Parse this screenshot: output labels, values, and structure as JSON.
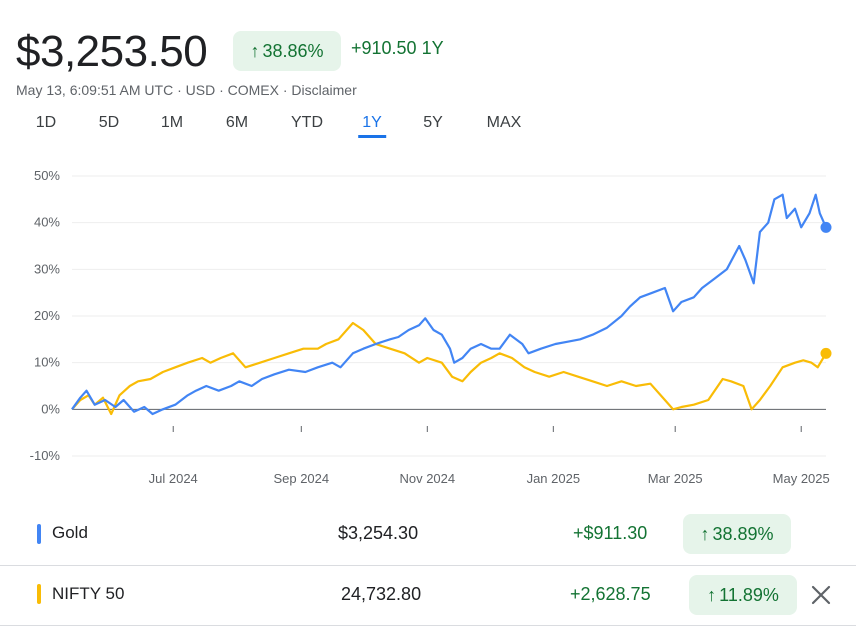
{
  "header": {
    "price": "$3,253.50",
    "change_pct": "38.86%",
    "change_abs": "+910.50 1Y",
    "meta": "May 13, 6:09:51 AM UTC · USD · COMEX · Disclaimer"
  },
  "tabs": [
    {
      "label": "1D",
      "active": false
    },
    {
      "label": "5D",
      "active": false
    },
    {
      "label": "1M",
      "active": false
    },
    {
      "label": "6M",
      "active": false
    },
    {
      "label": "YTD",
      "active": false
    },
    {
      "label": "1Y",
      "active": true
    },
    {
      "label": "5Y",
      "active": false
    },
    {
      "label": "MAX",
      "active": false
    }
  ],
  "chart_data": {
    "type": "line",
    "y_ticks": [
      "50%",
      "40%",
      "30%",
      "20%",
      "10%",
      "0%",
      "-10%"
    ],
    "ylim": [
      -10,
      50
    ],
    "xlim": [
      "2024-05-13",
      "2025-05-13"
    ],
    "x_ticks": [
      {
        "date": "2024-07-01",
        "label": "Jul 2024"
      },
      {
        "date": "2024-09-01",
        "label": "Sep 2024"
      },
      {
        "date": "2024-11-01",
        "label": "Nov 2024"
      },
      {
        "date": "2025-01-01",
        "label": "Jan 2025"
      },
      {
        "date": "2025-03-01",
        "label": "Mar 2025"
      },
      {
        "date": "2025-05-01",
        "label": "May 2025"
      }
    ],
    "grid": true,
    "series": [
      {
        "name": "Gold",
        "color": "#4285f4",
        "points": [
          [
            "2024-05-13",
            0
          ],
          [
            "2024-05-17",
            2.5
          ],
          [
            "2024-05-20",
            4
          ],
          [
            "2024-05-24",
            1
          ],
          [
            "2024-05-29",
            2
          ],
          [
            "2024-06-03",
            0.5
          ],
          [
            "2024-06-07",
            2
          ],
          [
            "2024-06-12",
            -0.5
          ],
          [
            "2024-06-17",
            0.5
          ],
          [
            "2024-06-21",
            -1
          ],
          [
            "2024-06-26",
            0
          ],
          [
            "2024-07-02",
            1
          ],
          [
            "2024-07-08",
            3
          ],
          [
            "2024-07-12",
            4
          ],
          [
            "2024-07-17",
            5
          ],
          [
            "2024-07-23",
            4
          ],
          [
            "2024-07-29",
            5
          ],
          [
            "2024-08-02",
            6
          ],
          [
            "2024-08-08",
            5
          ],
          [
            "2024-08-13",
            6.5
          ],
          [
            "2024-08-19",
            7.5
          ],
          [
            "2024-08-26",
            8.5
          ],
          [
            "2024-09-03",
            8
          ],
          [
            "2024-09-09",
            9
          ],
          [
            "2024-09-16",
            10
          ],
          [
            "2024-09-20",
            9
          ],
          [
            "2024-09-26",
            12
          ],
          [
            "2024-10-01",
            13
          ],
          [
            "2024-10-07",
            14
          ],
          [
            "2024-10-14",
            15
          ],
          [
            "2024-10-18",
            15.5
          ],
          [
            "2024-10-23",
            17
          ],
          [
            "2024-10-28",
            18
          ],
          [
            "2024-10-31",
            19.5
          ],
          [
            "2024-11-04",
            17
          ],
          [
            "2024-11-08",
            16
          ],
          [
            "2024-11-12",
            13
          ],
          [
            "2024-11-14",
            10
          ],
          [
            "2024-11-18",
            11
          ],
          [
            "2024-11-22",
            13
          ],
          [
            "2024-11-27",
            14
          ],
          [
            "2024-12-02",
            13
          ],
          [
            "2024-12-06",
            13
          ],
          [
            "2024-12-11",
            16
          ],
          [
            "2024-12-17",
            14
          ],
          [
            "2024-12-20",
            12
          ],
          [
            "2024-12-26",
            13
          ],
          [
            "2025-01-02",
            14
          ],
          [
            "2025-01-08",
            14.5
          ],
          [
            "2025-01-14",
            15
          ],
          [
            "2025-01-20",
            16
          ],
          [
            "2025-01-27",
            17.5
          ],
          [
            "2025-02-03",
            20
          ],
          [
            "2025-02-07",
            22
          ],
          [
            "2025-02-12",
            24
          ],
          [
            "2025-02-18",
            25
          ],
          [
            "2025-02-24",
            26
          ],
          [
            "2025-02-28",
            21
          ],
          [
            "2025-03-04",
            23
          ],
          [
            "2025-03-10",
            24
          ],
          [
            "2025-03-14",
            26
          ],
          [
            "2025-03-20",
            28
          ],
          [
            "2025-03-26",
            30
          ],
          [
            "2025-04-01",
            35
          ],
          [
            "2025-04-04",
            32
          ],
          [
            "2025-04-08",
            27
          ],
          [
            "2025-04-11",
            38
          ],
          [
            "2025-04-15",
            40
          ],
          [
            "2025-04-18",
            45
          ],
          [
            "2025-04-22",
            46
          ],
          [
            "2025-04-24",
            41
          ],
          [
            "2025-04-28",
            43
          ],
          [
            "2025-05-01",
            39
          ],
          [
            "2025-05-05",
            42
          ],
          [
            "2025-05-08",
            46
          ],
          [
            "2025-05-10",
            42
          ],
          [
            "2025-05-13",
            39
          ]
        ]
      },
      {
        "name": "NIFTY 50",
        "color": "#f9bc06",
        "points": [
          [
            "2024-05-13",
            0
          ],
          [
            "2024-05-17",
            2
          ],
          [
            "2024-05-21",
            3
          ],
          [
            "2024-05-24",
            1
          ],
          [
            "2024-05-28",
            2.5
          ],
          [
            "2024-06-01",
            -1
          ],
          [
            "2024-06-05",
            3
          ],
          [
            "2024-06-10",
            5
          ],
          [
            "2024-06-14",
            6
          ],
          [
            "2024-06-20",
            6.5
          ],
          [
            "2024-06-26",
            8
          ],
          [
            "2024-07-02",
            9
          ],
          [
            "2024-07-08",
            10
          ],
          [
            "2024-07-15",
            11
          ],
          [
            "2024-07-19",
            10
          ],
          [
            "2024-07-24",
            11
          ],
          [
            "2024-07-30",
            12
          ],
          [
            "2024-08-05",
            9
          ],
          [
            "2024-08-12",
            10
          ],
          [
            "2024-08-19",
            11
          ],
          [
            "2024-08-26",
            12
          ],
          [
            "2024-09-02",
            13
          ],
          [
            "2024-09-09",
            13
          ],
          [
            "2024-09-13",
            14
          ],
          [
            "2024-09-19",
            15
          ],
          [
            "2024-09-26",
            18.5
          ],
          [
            "2024-10-01",
            17
          ],
          [
            "2024-10-07",
            14
          ],
          [
            "2024-10-14",
            13
          ],
          [
            "2024-10-21",
            12
          ],
          [
            "2024-10-28",
            10
          ],
          [
            "2024-11-01",
            11
          ],
          [
            "2024-11-08",
            10
          ],
          [
            "2024-11-13",
            7
          ],
          [
            "2024-11-18",
            6
          ],
          [
            "2024-11-22",
            8
          ],
          [
            "2024-11-27",
            10
          ],
          [
            "2024-12-02",
            11
          ],
          [
            "2024-12-06",
            12
          ],
          [
            "2024-12-12",
            11
          ],
          [
            "2024-12-18",
            9
          ],
          [
            "2024-12-23",
            8
          ],
          [
            "2024-12-30",
            7
          ],
          [
            "2025-01-06",
            8
          ],
          [
            "2025-01-13",
            7
          ],
          [
            "2025-01-20",
            6
          ],
          [
            "2025-01-27",
            5
          ],
          [
            "2025-02-03",
            6
          ],
          [
            "2025-02-10",
            5
          ],
          [
            "2025-02-17",
            5.5
          ],
          [
            "2025-02-24",
            2
          ],
          [
            "2025-02-28",
            0
          ],
          [
            "2025-03-04",
            0.5
          ],
          [
            "2025-03-10",
            1
          ],
          [
            "2025-03-17",
            2
          ],
          [
            "2025-03-24",
            6.5
          ],
          [
            "2025-03-28",
            6
          ],
          [
            "2025-04-03",
            5
          ],
          [
            "2025-04-07",
            0
          ],
          [
            "2025-04-11",
            2
          ],
          [
            "2025-04-16",
            5
          ],
          [
            "2025-04-22",
            9
          ],
          [
            "2025-04-28",
            10
          ],
          [
            "2025-05-02",
            10.5
          ],
          [
            "2025-05-06",
            10
          ],
          [
            "2025-05-09",
            9
          ],
          [
            "2025-05-13",
            12
          ]
        ]
      }
    ]
  },
  "comparison": [
    {
      "name": "Gold",
      "value": "$3,254.30",
      "change_abs": "+$911.30",
      "change_pct": "38.89%",
      "color": "#4285f4"
    },
    {
      "name": "NIFTY 50",
      "value": "24,732.80",
      "change_abs": "+2,628.75",
      "change_pct": "11.89%",
      "color": "#f9bc06"
    }
  ],
  "icons": {
    "up": "arrow-up-icon",
    "close": "close-icon"
  }
}
